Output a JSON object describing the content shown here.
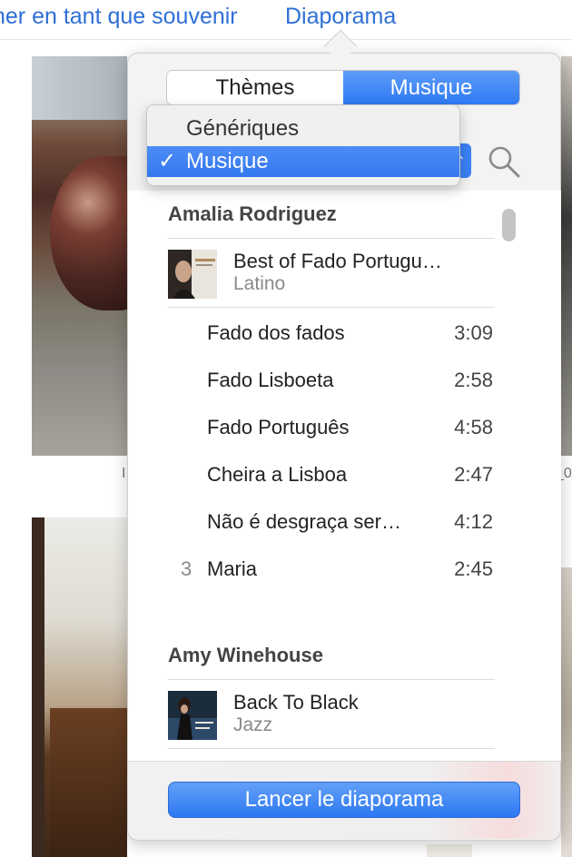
{
  "toolbar": {
    "souvenir_link": "ner en tant que souvenir",
    "diaporama_link": "Diaporama"
  },
  "background": {
    "stray_left": "I",
    "stray_right": "_0"
  },
  "popover": {
    "tabs": {
      "themes": "Thèmes",
      "music": "Musique",
      "selected": "Musique"
    },
    "source_menu": {
      "options": [
        "Génériques",
        "Musique"
      ],
      "selected": "Musique",
      "check_glyph": "✓"
    },
    "search_icon": "search-icon",
    "library": [
      {
        "artist": "Amalia Rodriguez",
        "album": {
          "title": "Best of Fado Portugu…",
          "genre": "Latino",
          "art_label": "AMALIA"
        },
        "tracks": [
          {
            "number": "",
            "title": "Fado dos fados",
            "duration": "3:09"
          },
          {
            "number": "",
            "title": "Fado Lisboeta",
            "duration": "2:58"
          },
          {
            "number": "",
            "title": "Fado Português",
            "duration": "4:58"
          },
          {
            "number": "",
            "title": "Cheira a Lisboa",
            "duration": "2:47"
          },
          {
            "number": "",
            "title": "Não é desgraça ser…",
            "duration": "4:12"
          },
          {
            "number": "3",
            "title": "Maria",
            "duration": "2:45"
          }
        ]
      },
      {
        "artist": "Amy Winehouse",
        "album": {
          "title": "Back To Black",
          "genre": "Jazz",
          "art_label": "AMY WINEHOUSE"
        },
        "tracks": []
      }
    ],
    "start_button": "Lancer le diaporama"
  },
  "colors": {
    "accent": "#2f7af4",
    "link": "#2f6fd6",
    "secondary_text": "#8a8a8a"
  }
}
